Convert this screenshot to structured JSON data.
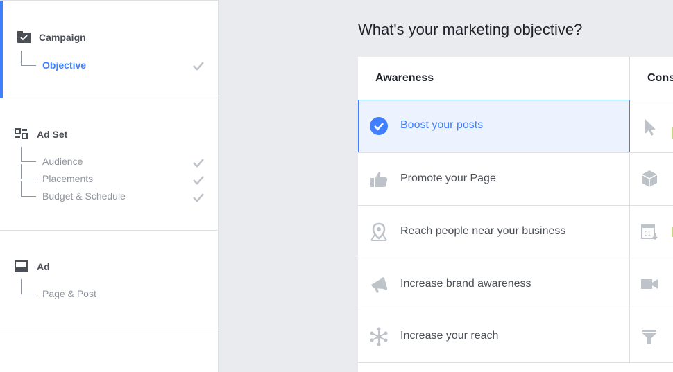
{
  "sidebar": {
    "campaign": {
      "label": "Campaign",
      "items": [
        {
          "label": "Objective"
        }
      ]
    },
    "adset": {
      "label": "Ad Set",
      "items": [
        {
          "label": "Audience"
        },
        {
          "label": "Placements"
        },
        {
          "label": "Budget & Schedule"
        }
      ]
    },
    "ad": {
      "label": "Ad",
      "items": [
        {
          "label": "Page & Post"
        }
      ]
    }
  },
  "main": {
    "title": "What's your marketing objective?",
    "columns": [
      {
        "label": "Awareness"
      },
      {
        "label": "Cons"
      }
    ],
    "awareness_items": [
      {
        "label": "Boost your posts",
        "icon": "check-circle-icon"
      },
      {
        "label": "Promote your Page",
        "icon": "thumbs-up-icon"
      },
      {
        "label": "Reach people near your business",
        "icon": "map-pin-icon"
      },
      {
        "label": "Increase brand awareness",
        "icon": "megaphone-icon"
      },
      {
        "label": "Increase your reach",
        "icon": "asterisk-reach-icon"
      }
    ],
    "consideration_icons": [
      "cursor-icon",
      "box-icon",
      "calendar-download-icon",
      "video-camera-icon",
      "funnel-icon"
    ]
  },
  "colors": {
    "accent": "#4080ff",
    "selected_bg": "#ecf3ff",
    "icon_gray": "#bec3c9",
    "text": "#4b4f56"
  }
}
